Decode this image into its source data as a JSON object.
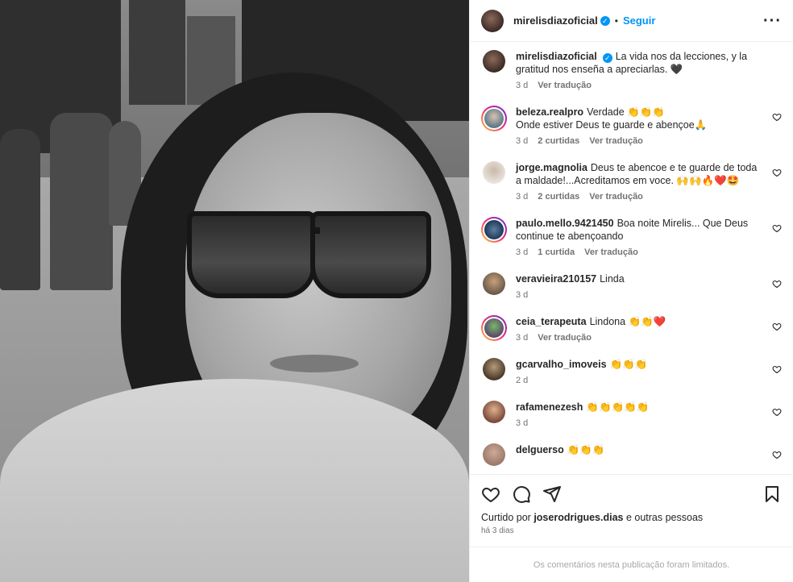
{
  "post": {
    "author": "mirelisdiazoficial",
    "follow_label": "Seguir",
    "caption": "La vida nos da lecciones, y la gratitud nos enseña a apreciarlas. 🖤",
    "caption_age": "3 d",
    "caption_translate": "Ver tradução"
  },
  "comments": [
    {
      "user": "beleza.realpro",
      "text": "Verdade 👏👏👏\nOnde estiver Deus te guarde e abençoe🙏",
      "age": "3 d",
      "likes": "2 curtidas",
      "translate": "Ver tradução",
      "avatar_icon": "avatar-icon"
    },
    {
      "user": "jorge.magnolia",
      "text": "Deus te abencoe e te guarde de toda a maldade!...Acreditamos em voce. 🙌🙌🔥❤️🤩",
      "age": "3 d",
      "likes": "2 curtidas",
      "translate": "Ver tradução",
      "avatar_icon": "avatar-icon"
    },
    {
      "user": "paulo.mello.9421450",
      "text": "Boa noite Mirelis... Que Deus continue te abençoando",
      "age": "3 d",
      "likes": "1 curtida",
      "translate": "Ver tradução",
      "avatar_icon": "avatar-icon"
    },
    {
      "user": "veravieira210157",
      "text": "Linda",
      "age": "3 d",
      "likes": "",
      "translate": "",
      "avatar_icon": "avatar-icon"
    },
    {
      "user": "ceia_terapeuta",
      "text": "Lindona 👏👏❤️",
      "age": "3 d",
      "likes": "",
      "translate": "Ver tradução",
      "avatar_icon": "avatar-icon"
    },
    {
      "user": "gcarvalho_imoveis",
      "text": "👏👏👏",
      "age": "2 d",
      "likes": "",
      "translate": "",
      "avatar_icon": "avatar-icon"
    },
    {
      "user": "rafamenezesh",
      "text": "👏👏👏👏👏",
      "age": "3 d",
      "likes": "",
      "translate": "",
      "avatar_icon": "avatar-icon"
    },
    {
      "user": "delguerso",
      "text": "👏👏👏",
      "age": "",
      "likes": "",
      "translate": "",
      "avatar_icon": "avatar-icon"
    }
  ],
  "footer": {
    "liked_prefix": "Curtido por",
    "liked_user": "joserodrigues.dias",
    "liked_suffix": "e outras pessoas",
    "time": "há 3 dias",
    "limited_notice": "Os comentários nesta publicação foram limitados."
  },
  "colors": {
    "accent": "#0095f6",
    "text": "#262626",
    "muted": "#737373"
  }
}
